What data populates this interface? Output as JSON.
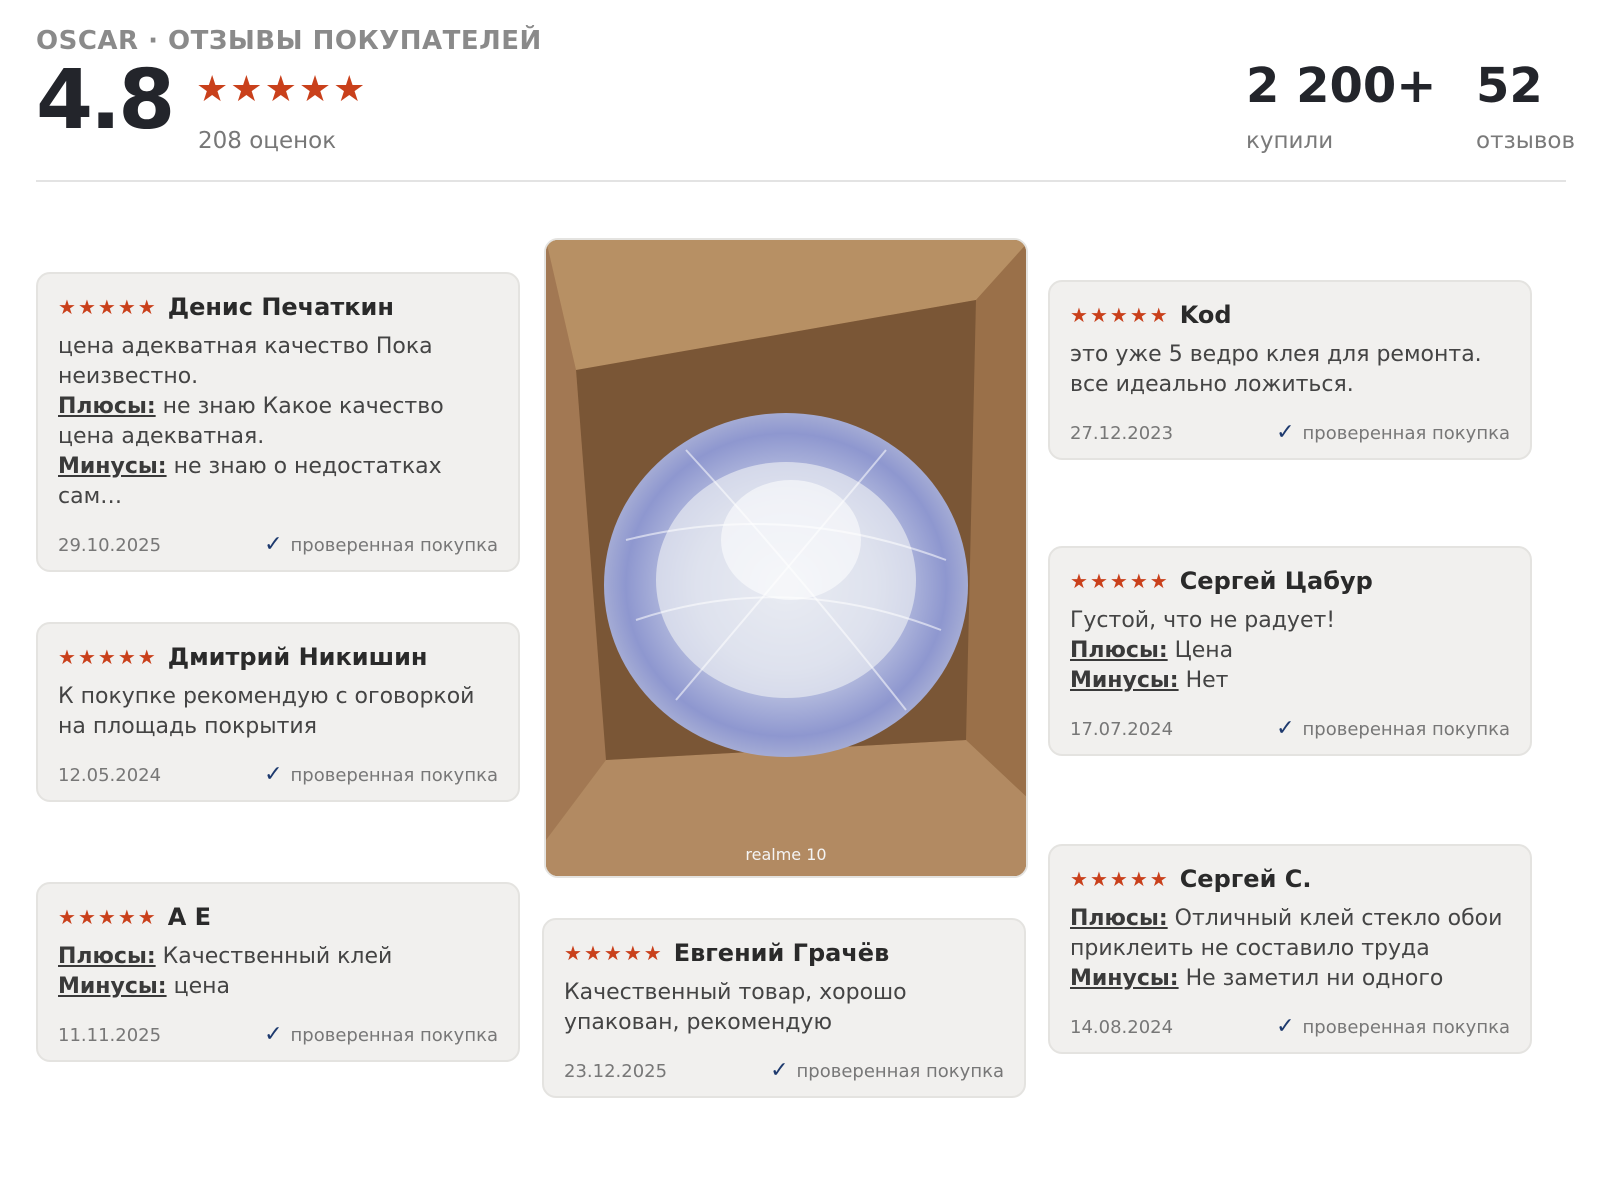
{
  "header": {
    "brand_line": "OSCAR · ОТЗЫВЫ ПОКУПАТЕЛЕЙ",
    "rating": "4.8",
    "rating_value": 4.8,
    "stars_filled": 5,
    "ratings_count": "208 оценок",
    "bought_num": "2 200+",
    "bought_label": "купили",
    "reviews_num": "52",
    "reviews_label": "отзывов"
  },
  "colors": {
    "star": "#c9401b",
    "card_bg": "#f1f0ee",
    "check": "#1e3a6e",
    "heading": "#23252b"
  },
  "icons": {
    "star": "star-icon",
    "check": "checkmark-icon"
  },
  "labels": {
    "pros": "Плюсы:",
    "cons": "Минусы:",
    "verified": "проверенная покупка"
  },
  "photo": {
    "caption": "realme 10",
    "alt": "Картонная коробка с ведром клея в пузырчатой плёнке"
  },
  "reviews": [
    {
      "name": "Денис Печаткин",
      "stars": 5,
      "text": "цена адекватная качество Пока неизвестно.",
      "pros": "не знаю Какое качество цена адекватная.",
      "cons": "не знаю о недостатках сам…",
      "date": "29.10.2025"
    },
    {
      "name": "Дмитрий Никишин",
      "stars": 5,
      "text": "К покупке рекомендую с оговоркой на площадь покрытия",
      "date": "12.05.2024"
    },
    {
      "name": "A E",
      "stars": 5,
      "pros": "Качественный клей",
      "cons": "цена",
      "date": "11.11.2025"
    },
    {
      "name": "Евгений Грачёв",
      "stars": 5,
      "text": "Качественный товар, хорошо упакован, рекомендую",
      "date": "23.12.2025"
    },
    {
      "name": "Kod",
      "stars": 5,
      "text": "это уже 5 ведро клея для ремонта. все идеально ложиться.",
      "date": "27.12.2023"
    },
    {
      "name": "Сергей Цабур",
      "stars": 5,
      "text": "Густой, что не радует!",
      "pros": "Цена",
      "cons": "Нет",
      "date": "17.07.2024"
    },
    {
      "name": "Сергей С.",
      "stars": 5,
      "pros": "Отличный клей стекло обои приклеить не составило труда",
      "cons": "Не заметил ни одного",
      "date": "14.08.2024"
    }
  ]
}
